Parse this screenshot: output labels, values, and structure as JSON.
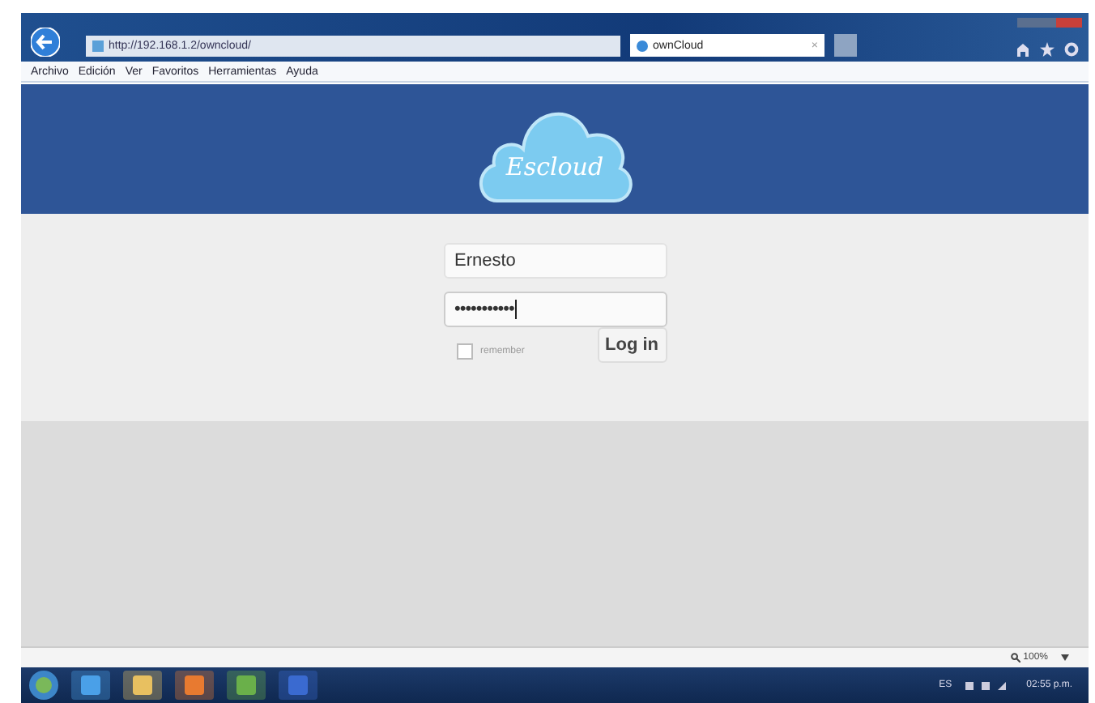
{
  "browser": {
    "address": "http://192.168.1.2/owncloud/",
    "tab": "ownCloud",
    "tab_close": "×",
    "menu": [
      "Archivo",
      "Edición",
      "Ver",
      "Favoritos",
      "Herramientas",
      "Ayuda"
    ]
  },
  "login": {
    "logo": "Escloud",
    "username": "Ernesto",
    "password": "•••••••••••",
    "remember": {
      "label": "remember",
      "checked": false
    },
    "button": "Log in"
  },
  "status_bar": {
    "zoom": "100%"
  },
  "taskbar": {
    "language": "ES",
    "clock": "02:55 p.m."
  }
}
